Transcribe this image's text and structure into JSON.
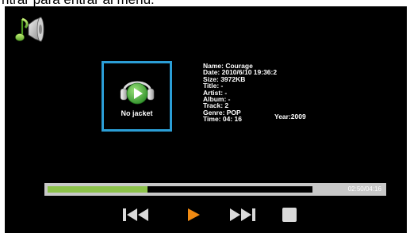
{
  "top_caption": "ntrar para entrar al menú.",
  "cover": {
    "label": "No jacket"
  },
  "track_info": {
    "name": "Name: Courage",
    "date": "Date: 2010/6/10  19:36:2",
    "size": "Size: 3972KB",
    "title": "Title: -",
    "artist": "Artist: -",
    "album": "Album: -",
    "track": "Track:  2",
    "year": "Year:2009",
    "genre": "Genre: POP",
    "time": "Time: 04: 16"
  },
  "playback": {
    "time_display": "02:50/04:16",
    "progress_fraction": 0.378
  },
  "controls": {
    "prev_icon": "skip-previous-icon",
    "play_icon": "play-icon",
    "next_icon": "skip-next-icon",
    "stop_icon": "stop-icon"
  },
  "colors": {
    "accent_border": "#2b9ed6",
    "progress_fill": "#8cc24a",
    "play_button": "#f08a12",
    "control_gray": "#d9d9d9"
  }
}
